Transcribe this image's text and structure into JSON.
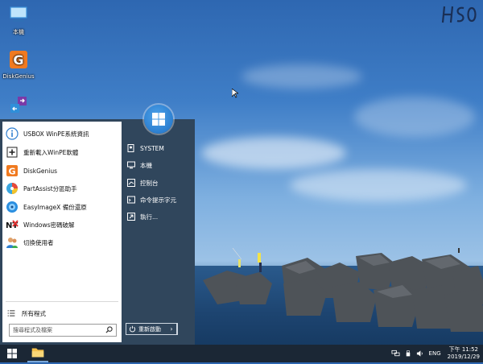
{
  "desktop": {
    "icons": [
      {
        "label": "本機",
        "icon": "computer-icon"
      },
      {
        "label": "DiskGenius",
        "icon": "diskgenius-icon"
      },
      {
        "label": "",
        "icon": "transfer-icon"
      }
    ]
  },
  "start_menu": {
    "apps": [
      {
        "label": "USBOX WinPE系統資訊",
        "icon": "info-icon"
      },
      {
        "label": "重新載入WinPE軟體",
        "icon": "plus-icon"
      },
      {
        "label": "DiskGenius",
        "icon": "diskgenius-icon"
      },
      {
        "label": "PartAssist分區助手",
        "icon": "partassist-icon"
      },
      {
        "label": "EasyImageX 備份還原",
        "icon": "easyimagex-icon"
      },
      {
        "label": "Windows密碼破解",
        "icon": "ntpwd-icon"
      },
      {
        "label": "切換使用者",
        "icon": "users-icon"
      }
    ],
    "all_programs": "所有程式",
    "search_placeholder": "搜尋程式及檔案",
    "right": [
      {
        "label": "SYSTEM",
        "icon": "user-doc-icon"
      },
      {
        "label": "本機",
        "icon": "monitor-icon"
      },
      {
        "label": "控制台",
        "icon": "control-panel-icon"
      },
      {
        "label": "命令提示字元",
        "icon": "cmd-icon"
      },
      {
        "label": "執行...",
        "icon": "run-icon"
      }
    ],
    "restart_label": "重新啟動",
    "restart_arrow": "›"
  },
  "taskbar": {
    "tray": {
      "lang": "ENG",
      "time": "下午 11:52",
      "date": "2019/12/29"
    }
  },
  "colors": {
    "menu_panel": "#30465c",
    "taskbar": "#1b2735",
    "win_blue": "#2c7fd0"
  }
}
